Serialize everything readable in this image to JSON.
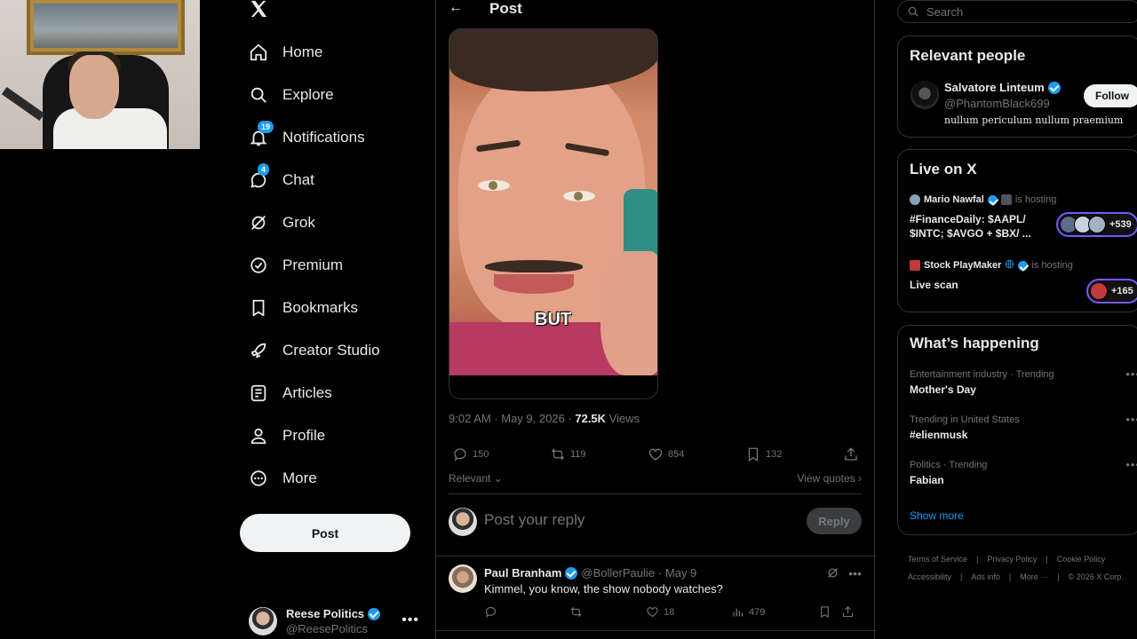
{
  "nav": {
    "items": [
      {
        "label": "Home",
        "icon": "home-icon"
      },
      {
        "label": "Explore",
        "icon": "search-icon"
      },
      {
        "label": "Notifications",
        "icon": "bell-icon",
        "badge": "19"
      },
      {
        "label": "Chat",
        "icon": "chat-icon",
        "badge": "4"
      },
      {
        "label": "Grok",
        "icon": "grok-icon"
      },
      {
        "label": "Premium",
        "icon": "premium-icon"
      },
      {
        "label": "Bookmarks",
        "icon": "bookmark-icon"
      },
      {
        "label": "Creator Studio",
        "icon": "rocket-icon"
      },
      {
        "label": "Articles",
        "icon": "article-icon"
      },
      {
        "label": "Profile",
        "icon": "profile-icon"
      },
      {
        "label": "More",
        "icon": "more-circle-icon"
      }
    ],
    "post_button": "Post",
    "account": {
      "name": "Reese Politics",
      "handle": "@ReesePolitics",
      "menu": "•••"
    }
  },
  "main": {
    "header_title": "Post",
    "back_glyph": "←",
    "media_caption": "BUT",
    "timestamp": "9:02 AM · May 9, 2026 · ",
    "views_count": "72.5K",
    "views_label": " Views",
    "stats": {
      "replies": "150",
      "reposts": "119",
      "likes": "854",
      "bookmarks": "132"
    },
    "sort_label": "Relevant ⌄",
    "view_quotes": "View quotes ›",
    "reply_placeholder": "Post your reply",
    "reply_button": "Reply",
    "reply": {
      "name": "Paul Branham",
      "handle": "@BollerPaulie",
      "date": "· May 9",
      "text": "Kimmel, you know, the show nobody watches?",
      "likes": "18",
      "views": "479",
      "menu": "•••"
    }
  },
  "sidebar": {
    "search_placeholder": "Search",
    "relevant_title": "Relevant people",
    "person": {
      "name": "Salvatore Linteum",
      "handle": "@PhantomBlack699",
      "bio": "nullum periculum nullum praemium",
      "follow_label": "Follow"
    },
    "live_title": "Live on X",
    "live": [
      {
        "host": "Mario Nawfal",
        "hosting": "is hosting",
        "title_line1": "#FinanceDaily: $AAPL/",
        "title_line2": "$INTC; $AVGO + $BX/ ...",
        "count": "+539"
      },
      {
        "host": "Stock PlayMaker",
        "hosting": "is hosting",
        "title_line1": "Live scan",
        "count": "+165"
      }
    ],
    "happening_title": "What’s happening",
    "trends": [
      {
        "meta": "Entertainment industry · Trending",
        "topic": "Mother's Day"
      },
      {
        "meta": "Trending in United States",
        "topic": "#elienmusk"
      },
      {
        "meta": "Politics · Trending",
        "topic": "Fabian"
      }
    ],
    "trend_menu": "•••",
    "show_more": "Show more",
    "footer": [
      "Terms of Service",
      "|",
      "Privacy Policy",
      "|",
      "Cookie Policy",
      "|",
      "Accessibility",
      "|",
      "Ads info",
      "|",
      "More ···",
      "|",
      "© 2026 X Corp."
    ]
  },
  "colors": {
    "accent": "#1d9bf0",
    "background": "#000000",
    "text": "#e7e9ea",
    "muted": "#71767b",
    "border": "#2f3336",
    "live": "#7856ff"
  }
}
